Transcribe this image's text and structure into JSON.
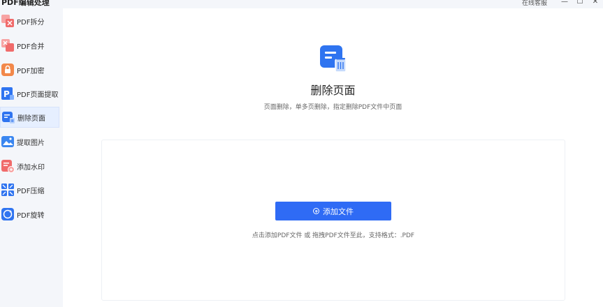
{
  "window": {
    "title": "PDF编辑处理",
    "service_label": "在线客服",
    "minimize_glyph": "—",
    "maximize_glyph": "☐",
    "close_glyph": "✕"
  },
  "sidebar": {
    "items": [
      {
        "label": "PDF拆分",
        "icon": "pdf-split-icon",
        "color": "#f06b6b"
      },
      {
        "label": "PDF合并",
        "icon": "pdf-merge-icon",
        "color": "#f06b6b"
      },
      {
        "label": "PDF加密",
        "icon": "pdf-encrypt-icon",
        "color": "#f2884a"
      },
      {
        "label": "PDF页面提取",
        "icon": "pdf-page-extract-icon",
        "color": "#2f74f0"
      },
      {
        "label": "删除页面",
        "icon": "delete-page-icon",
        "color": "#2f74f0"
      },
      {
        "label": "提取图片",
        "icon": "extract-image-icon",
        "color": "#3a86f0"
      },
      {
        "label": "添加水印",
        "icon": "add-watermark-icon",
        "color": "#f06b6b"
      },
      {
        "label": "PDF压缩",
        "icon": "pdf-compress-icon",
        "color": "#2f74f0"
      },
      {
        "label": "PDF旋转",
        "icon": "pdf-rotate-icon",
        "color": "#2f74f0"
      }
    ],
    "active_label": "删除页面"
  },
  "main": {
    "title": "删除页面",
    "description": "页面删除，单多页删除，指定删除PDF文件中页面",
    "add_button_label": "添加文件",
    "drop_hint": "点击添加PDF文件 或 拖拽PDF文件至此，支持格式：.PDF"
  },
  "colors": {
    "accent": "#2f6bf5",
    "active_bg": "#e6efff",
    "red_icon": "#f06b6b",
    "orange_icon": "#f2884a",
    "blue_icon": "#2f74f0"
  }
}
